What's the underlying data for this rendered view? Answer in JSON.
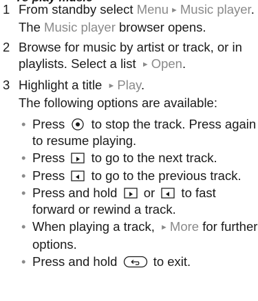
{
  "cut_title": "To play music",
  "steps": [
    {
      "num": "1",
      "a": "From standby select ",
      "menu": "Menu",
      "b": "Music player",
      "c": ". The ",
      "d": "Music player",
      "e": " browser opens."
    },
    {
      "num": "2",
      "a": "Browse for music by artist or track, or in playlists. Select a list ",
      "b": "Open",
      "c": "."
    },
    {
      "num": "3",
      "a": "Highlight a title ",
      "b": "Play",
      "c": "."
    }
  ],
  "options_intro": "The following options are available:",
  "bullets": [
    {
      "a": "Press ",
      "icon": "center-key-icon",
      "b": " to stop the track. Press again to resume playing."
    },
    {
      "a": "Press ",
      "icon": "next-key-icon",
      "b": " to go to the next track."
    },
    {
      "a": "Press ",
      "icon": "prev-key-icon",
      "b": " to go to the previous track."
    },
    {
      "a": "Press and hold ",
      "icon1": "next-key-icon",
      "mid": " or ",
      "icon2": "prev-key-icon",
      "b": " to fast forward or rewind a track."
    },
    {
      "a": "When playing a track, ",
      "link": "More",
      "b": " for further options."
    },
    {
      "a": "Press and hold ",
      "icon": "back-key-icon",
      "b": " to exit."
    }
  ],
  "bullet_glyph": "•",
  "arrow_glyph": "►",
  "colors": {
    "text": "#1a1a1a",
    "ui_term": "#8a8a8a"
  }
}
